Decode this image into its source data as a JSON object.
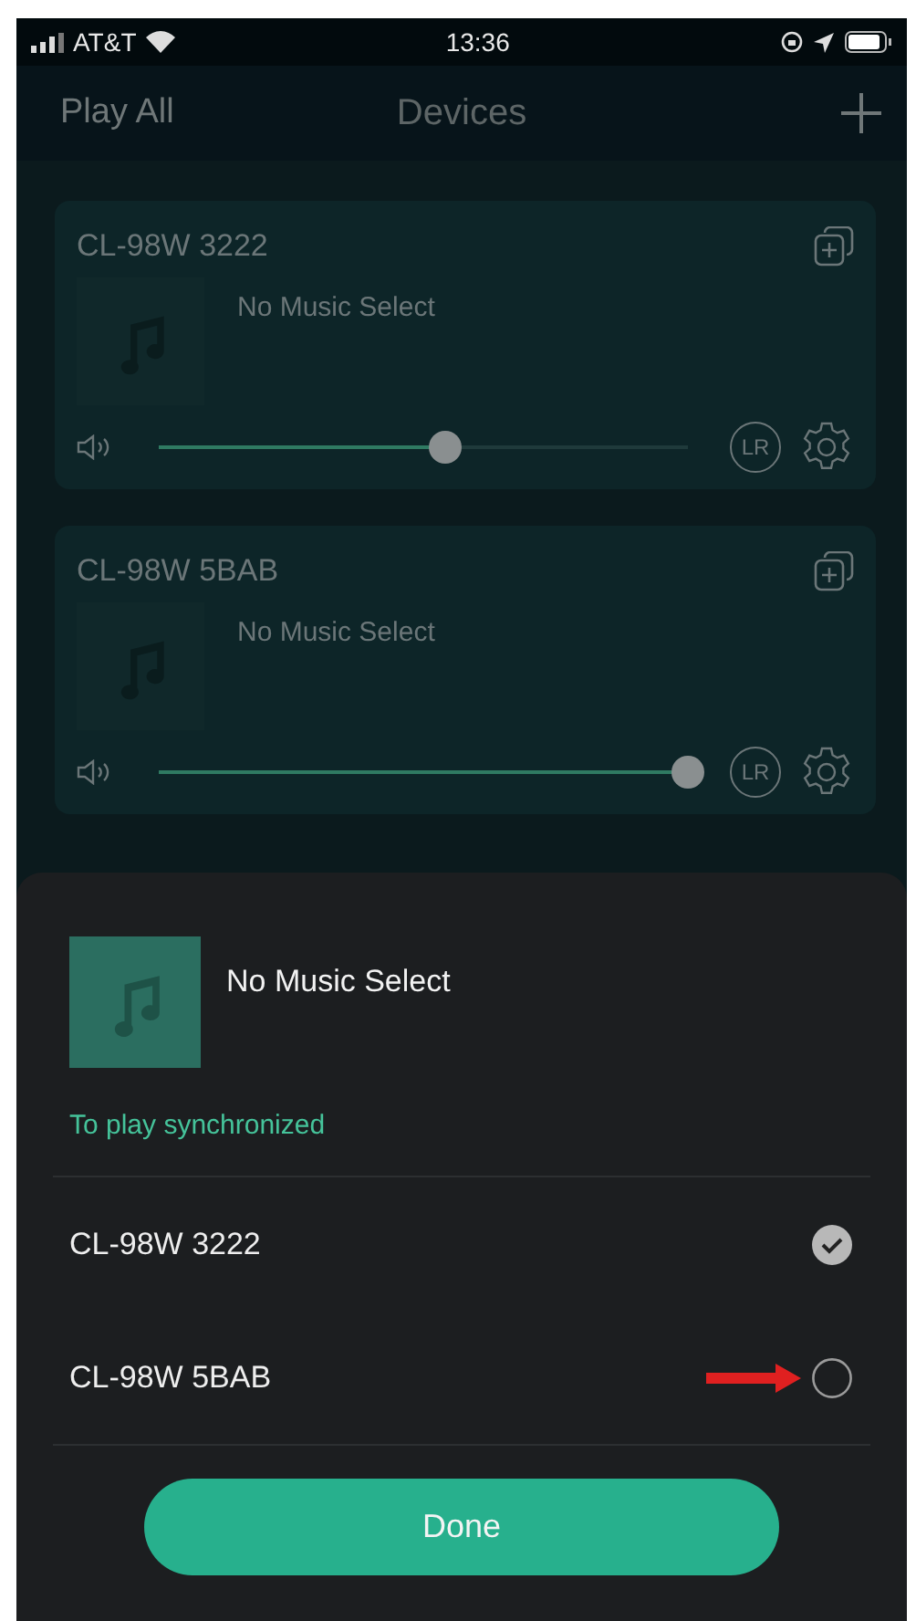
{
  "status_bar": {
    "carrier": "AT&T",
    "time": "13:36"
  },
  "nav": {
    "left_action": "Play All",
    "title": "Devices"
  },
  "devices": [
    {
      "name": "CL-98W 3222",
      "track": "No Music Select",
      "level": 0.54,
      "channel_button": "LR"
    },
    {
      "name": "CL-98W 5BAB",
      "track": "No Music Select",
      "level": 1,
      "channel_button": "LR"
    }
  ],
  "sheet": {
    "track": "No Music Select",
    "hint": "To play synchronized",
    "speakers": [
      {
        "name": "CL-98W 3222",
        "checked": true
      },
      {
        "name": "CL-98W 5BAB",
        "checked": false
      }
    ],
    "done_button": "Done"
  }
}
